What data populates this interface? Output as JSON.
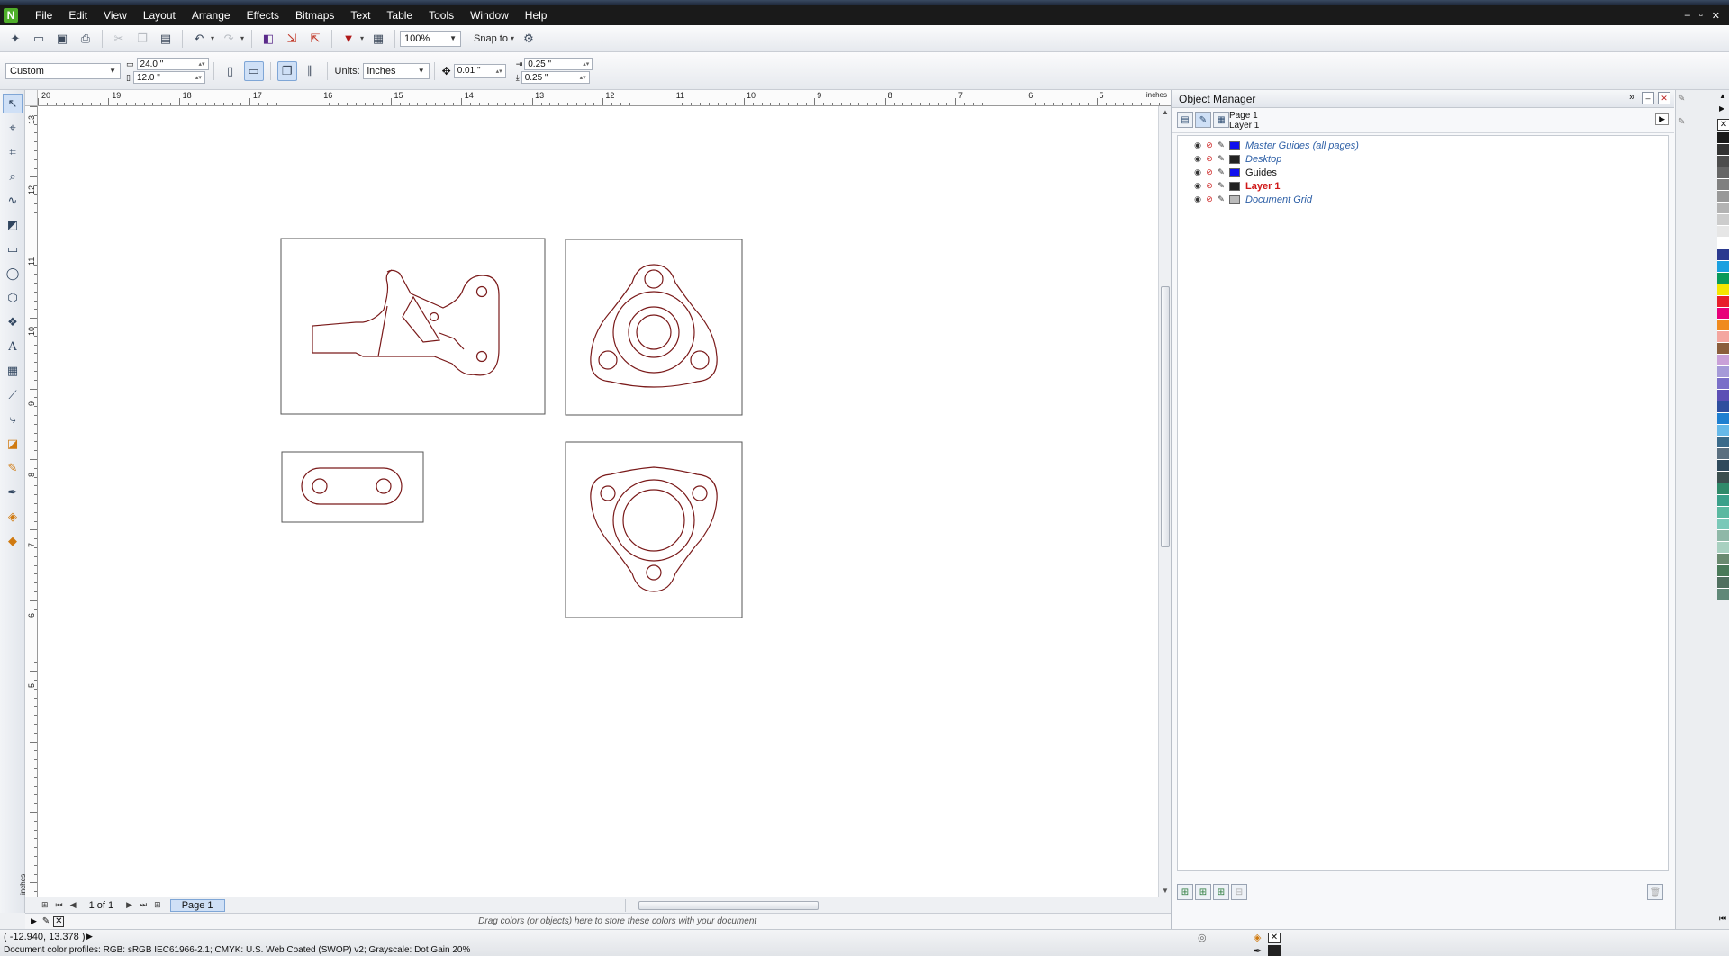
{
  "menu": [
    "File",
    "Edit",
    "View",
    "Layout",
    "Arrange",
    "Effects",
    "Bitmaps",
    "Text",
    "Table",
    "Tools",
    "Window",
    "Help"
  ],
  "toolbar1": {
    "zoom": "100%",
    "snap_to": "Snap to"
  },
  "toolbar2": {
    "page_size": "Custom",
    "width": "24.0 \"",
    "height": "12.0 \"",
    "units_label": "Units:",
    "units_value": "inches",
    "nudge": "0.01 \"",
    "dup_x": "0.25 \"",
    "dup_y": "0.25 \""
  },
  "rulers": {
    "unit": "inches",
    "horizontal_labels": [
      "20",
      "19",
      "18",
      "17",
      "16",
      "15",
      "14",
      "13",
      "12",
      "11",
      "10",
      "9",
      "8",
      "7",
      "6",
      "5"
    ],
    "vertical_labels": [
      "13",
      "12",
      "11",
      "10",
      "9",
      "8",
      "7",
      "6",
      "5"
    ]
  },
  "pagebar": {
    "page_count": "1 of 1",
    "page_tab": "Page 1"
  },
  "color_tray": {
    "hint": "Drag colors (or objects) here to store these colors with your document"
  },
  "status": {
    "coords": "( -12.940, 13.378 )",
    "profiles": "Document color profiles: RGB: sRGB IEC61966-2.1; CMYK: U.S. Web Coated (SWOP) v2; Grayscale: Dot Gain 20%"
  },
  "docker": {
    "title": "Object Manager",
    "page": "Page 1",
    "layer": "Layer 1",
    "layers": [
      {
        "name": "Master Guides (all pages)",
        "swatch": "#1010ee",
        "style": "master"
      },
      {
        "name": "Desktop",
        "swatch": "#222222",
        "style": "master"
      },
      {
        "name": "Guides",
        "swatch": "#1010ee",
        "style": "normal"
      },
      {
        "name": "Layer 1",
        "swatch": "#222222",
        "style": "active"
      },
      {
        "name": "Document Grid",
        "swatch": "#bbbbbb",
        "style": "master"
      }
    ]
  },
  "colors": {
    "drawing_stroke": "#7a1a1a",
    "palette": [
      "#1a1a1a",
      "#333333",
      "#4d4d4d",
      "#666666",
      "#808080",
      "#999999",
      "#b3b3b3",
      "#cccccc",
      "#e6e6e6",
      "#ffffff",
      "#2b3a8f",
      "#1aa0e0",
      "#0a9a5a",
      "#f5e600",
      "#e81f2a",
      "#e8007a",
      "#f08a1e",
      "#f4a6a0",
      "#8b5e3c",
      "#c9a0d8",
      "#a59ad8",
      "#7a6fc8",
      "#5c4fb5",
      "#2e4e9e",
      "#1f7fd0",
      "#66b8e8",
      "#3a6a8a",
      "#5a6f80",
      "#2f4a5c",
      "#3b4f4f",
      "#2f8a6a",
      "#3aa08a",
      "#5ab8a0",
      "#7ac8b8",
      "#8fb8a8",
      "#a8d0c0",
      "#6a8a70",
      "#4a7a5a",
      "#507060",
      "#608878"
    ]
  }
}
